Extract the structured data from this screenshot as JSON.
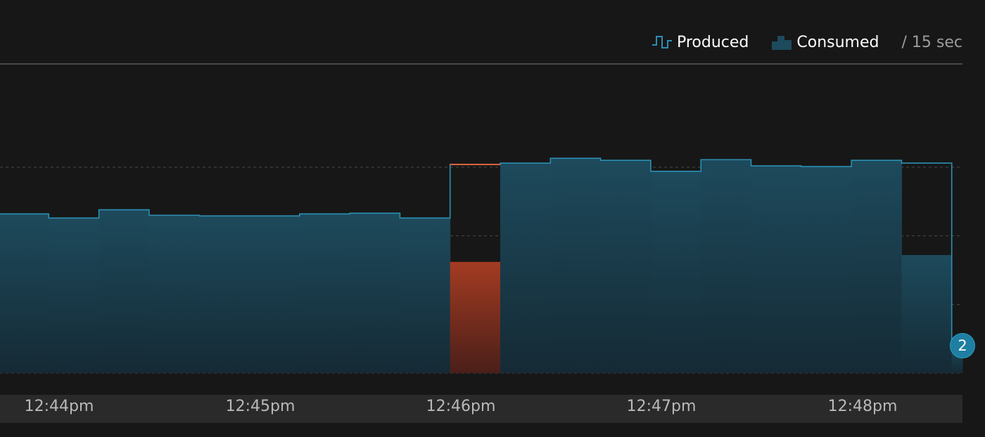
{
  "legend": {
    "produced_label": "Produced",
    "consumed_label": "Consumed",
    "rate_label": "/ 15 sec",
    "produced_icon": "step-line-icon",
    "consumed_icon": "step-area-icon"
  },
  "badge": {
    "value": "2"
  },
  "colors": {
    "background": "#171717",
    "produced_line": "#2c8fb3",
    "consumed_fill_top": "#1d4a5c",
    "consumed_fill_bottom": "#152a35",
    "deficit_fill_top": "#a43b22",
    "deficit_fill_bottom": "#4a1f19",
    "deficit_line": "#e0623b",
    "grid": "#4a4a4a",
    "axis_bar": "#2a2a2a",
    "tick_text": "#b9b9b9"
  },
  "chart_data": {
    "type": "area",
    "x_ticks": [
      "12:44pm",
      "12:45pm",
      "12:46pm",
      "12:47pm",
      "12:48pm"
    ],
    "ylim": [
      0,
      15
    ],
    "gridlines": [
      5,
      10,
      15
    ],
    "grid": true,
    "legend_position": "top-right",
    "bucket_seconds": 15,
    "x": [
      "12:43:45",
      "12:44:00",
      "12:44:15",
      "12:44:30",
      "12:44:45",
      "12:45:00",
      "12:45:15",
      "12:45:30",
      "12:45:45",
      "12:46:00",
      "12:46:15",
      "12:46:30",
      "12:46:45",
      "12:47:00",
      "12:47:15",
      "12:47:30",
      "12:47:45",
      "12:48:00",
      "12:48:15",
      "12:48:30"
    ],
    "series": [
      {
        "name": "Produced",
        "values": [
          11.6,
          11.3,
          11.9,
          11.5,
          11.45,
          11.45,
          11.6,
          11.65,
          11.3,
          15.2,
          15.3,
          15.65,
          15.5,
          14.7,
          15.55,
          15.1,
          15.05,
          15.5,
          15.3,
          2
        ]
      },
      {
        "name": "Consumed",
        "values": [
          11.6,
          11.3,
          11.9,
          11.5,
          11.45,
          11.45,
          11.6,
          11.65,
          11.3,
          8.1,
          15.3,
          15.65,
          15.5,
          14.7,
          15.55,
          15.1,
          15.05,
          15.5,
          8.6,
          2
        ]
      }
    ]
  }
}
